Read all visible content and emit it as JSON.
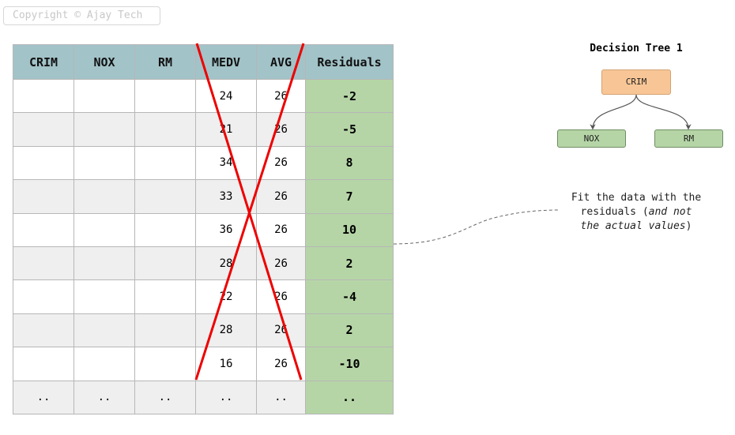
{
  "copyright": "Copyright © Ajay Tech",
  "table": {
    "headers": [
      "CRIM",
      "NOX",
      "RM",
      "MEDV",
      "AVG",
      "Residuals"
    ],
    "rows": [
      [
        "",
        "",
        "",
        "24",
        "26",
        "-2"
      ],
      [
        "",
        "",
        "",
        "21",
        "26",
        "-5"
      ],
      [
        "",
        "",
        "",
        "34",
        "26",
        "8"
      ],
      [
        "",
        "",
        "",
        "33",
        "26",
        "7"
      ],
      [
        "",
        "",
        "",
        "36",
        "26",
        "10"
      ],
      [
        "",
        "",
        "",
        "28",
        "26",
        "2"
      ],
      [
        "",
        "",
        "",
        "22",
        "26",
        "-4"
      ],
      [
        "",
        "",
        "",
        "28",
        "26",
        "2"
      ],
      [
        "",
        "",
        "",
        "16",
        "26",
        "-10"
      ],
      [
        "..",
        "..",
        "..",
        "..",
        "..",
        ".."
      ]
    ]
  },
  "tree": {
    "title": "Decision Tree 1",
    "root": "CRIM",
    "left": "NOX",
    "right": "RM"
  },
  "note": {
    "line1": "Fit the data with the",
    "line2_plain": "residuals (",
    "line2_em": "and not",
    "line3_em": "the actual values",
    "line3_plain": ")"
  },
  "colors": {
    "header": "#a2c3c8",
    "residual": "#b5d5a6",
    "alt_row": "#efefef",
    "root_node": "#f8c696",
    "cross": "#ee0000"
  }
}
